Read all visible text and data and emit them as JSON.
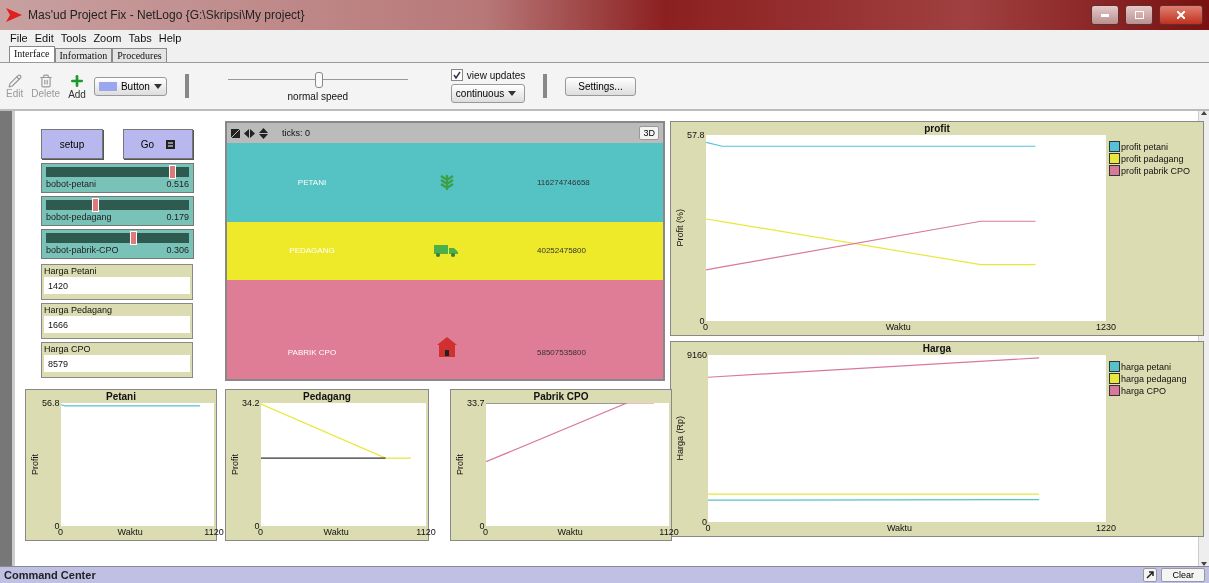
{
  "window": {
    "title": "Mas'ud Project Fix - NetLogo {G:\\Skripsi\\My project}"
  },
  "menu": [
    "File",
    "Edit",
    "Tools",
    "Zoom",
    "Tabs",
    "Help"
  ],
  "tabs": [
    {
      "label": "Interface",
      "selected": true
    },
    {
      "label": "Information",
      "selected": false
    },
    {
      "label": "Procedures",
      "selected": false
    }
  ],
  "toolbar": {
    "tools": [
      {
        "kind": "edit",
        "label": "Edit",
        "disabled": true
      },
      {
        "kind": "delete",
        "label": "Delete",
        "disabled": true
      },
      {
        "kind": "add",
        "label": "Add",
        "disabled": false
      }
    ],
    "widget_type": "Button",
    "speed": {
      "label": "normal speed",
      "level": 0.5
    },
    "view_updates": {
      "label": "view updates",
      "checked": true
    },
    "update_mode": "continuous",
    "settings_button": "Settings..."
  },
  "buttons": [
    {
      "label": "setup",
      "forever": false
    },
    {
      "label": "Go",
      "forever": true
    }
  ],
  "sliders": [
    {
      "name": "bobot-petani",
      "value": "0.516",
      "level": 0.88
    },
    {
      "name": "bobot-pedagang",
      "value": "0.179",
      "level": 0.34
    },
    {
      "name": "bobot-pabrik-CPO",
      "value": "0.306",
      "level": 0.61
    }
  ],
  "monitors": [
    {
      "label": "Harga Petani",
      "value": "1420"
    },
    {
      "label": "Harga Pedagang",
      "value": "1666"
    },
    {
      "label": "Harga CPO",
      "value": "8579"
    }
  ],
  "view": {
    "ticks_label": "ticks:",
    "ticks": "0",
    "button_3d": "3D",
    "bands": [
      {
        "kind": "plant",
        "label": "PETANI",
        "value": "116274746658",
        "color": "#55c2c4"
      },
      {
        "kind": "truck",
        "label": "PEDAGANG",
        "value": "40252475800",
        "color": "#eeea2a"
      },
      {
        "kind": "house",
        "label": "PABRIK CPO",
        "value": "58507535800",
        "color": "#df7d96"
      }
    ]
  },
  "plots": [
    {
      "chart_data": {
        "type": "line",
        "title": "profit",
        "xlabel": "Waktu",
        "ylabel": "Profit (%)",
        "x": [
          0,
          50,
          844,
          1012
        ],
        "legend": "right",
        "xlim": [
          0,
          1230
        ],
        "ylim": [
          0,
          57.8
        ],
        "xticks": [
          0,
          1230
        ],
        "yticks": [
          0,
          57.8
        ],
        "series": [
          {
            "name": "profit petani",
            "color": "#55c2d8",
            "values": [
              55.5,
              54.3,
              54.3,
              54.3
            ]
          },
          {
            "name": "profit padagang",
            "color": "#e8e83c",
            "values": [
              31.7,
              30.9,
              17.5,
              17.5
            ]
          },
          {
            "name": "profit pabrik CPO",
            "color": "#d9789a",
            "values": [
              15.9,
              16.8,
              31.0,
              31.0
            ]
          }
        ]
      }
    },
    {
      "chart_data": {
        "type": "line",
        "title": "Harga",
        "xlabel": "Waktu",
        "ylabel": "Harga (Rp)",
        "x": [
          0,
          1015
        ],
        "legend": "right",
        "xlim": [
          0,
          1220
        ],
        "ylim": [
          0,
          9160
        ],
        "xticks": [
          0,
          1220
        ],
        "yticks": [
          0,
          9160
        ],
        "series": [
          {
            "name": "harga petani",
            "color": "#55c2c8",
            "values": [
              1200,
              1230
            ]
          },
          {
            "name": "harga pedagang",
            "color": "#e8e83c",
            "values": [
              1530,
              1530
            ]
          },
          {
            "name": "harga CPO",
            "color": "#d9789a",
            "values": [
              7940,
              9000
            ]
          }
        ]
      }
    },
    {
      "chart_data": {
        "type": "line",
        "title": "Petani",
        "xlabel": "Waktu",
        "ylabel": "Profit",
        "x": [
          0,
          30,
          1015
        ],
        "xlim": [
          0,
          1120
        ],
        "ylim": [
          0,
          56.8
        ],
        "xticks": [
          0,
          1120
        ],
        "yticks": [
          0,
          56.8
        ],
        "series": [
          {
            "color": "#55c2d8",
            "values": [
              56.0,
              55.5,
              55.5
            ]
          }
        ]
      }
    },
    {
      "chart_data": {
        "type": "line",
        "title": "Pedagang",
        "xlabel": "Waktu",
        "ylabel": "Profit",
        "x": [
          0,
          843,
          1015
        ],
        "xlim": [
          0,
          1120
        ],
        "ylim": [
          0,
          34.2
        ],
        "xticks": [
          0,
          1120
        ],
        "yticks": [
          0,
          34.2
        ],
        "series": [
          {
            "color": "#e8e83c",
            "values": [
              33.9,
              18.9,
              18.9
            ]
          },
          {
            "color": "#333333",
            "values": [
              18.9,
              18.9,
              null
            ]
          }
        ]
      }
    },
    {
      "chart_data": {
        "type": "line",
        "title": "Pabrik CPO",
        "xlabel": "Waktu",
        "ylabel": "Profit",
        "x": [
          0,
          860,
          1025
        ],
        "xlim": [
          0,
          1120
        ],
        "ylim": [
          0,
          33.7
        ],
        "xticks": [
          0,
          1120
        ],
        "yticks": [
          0,
          33.7
        ],
        "series": [
          {
            "color": "#333333",
            "values": [
              33.7,
              33.7,
              null
            ]
          },
          {
            "color": "#d9789a",
            "values": [
              17.6,
              33.7,
              33.7
            ]
          }
        ]
      }
    }
  ],
  "command_center": {
    "title": "Command Center",
    "clear_button": "Clear"
  }
}
